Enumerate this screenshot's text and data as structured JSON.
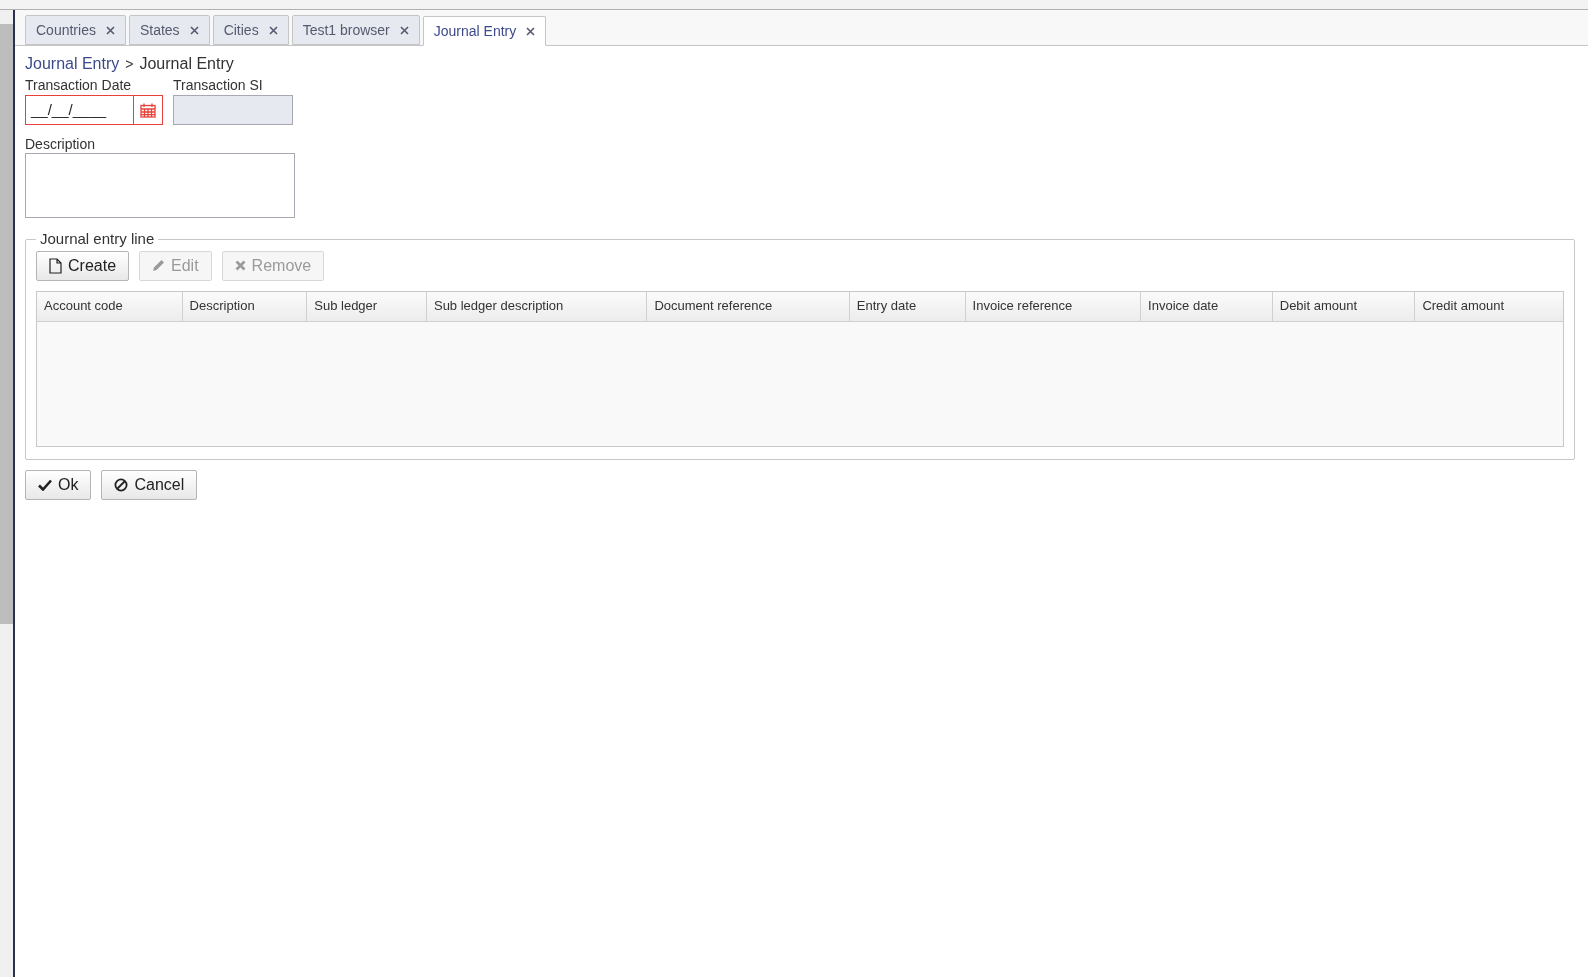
{
  "tabs": [
    {
      "label": "Countries",
      "selected": false
    },
    {
      "label": "States",
      "selected": false
    },
    {
      "label": "Cities",
      "selected": false
    },
    {
      "label": "Test1 browser",
      "selected": false
    },
    {
      "label": "Journal Entry",
      "selected": true
    }
  ],
  "breadcrumb": {
    "link": "Journal Entry",
    "separator": ">",
    "current": "Journal Entry"
  },
  "form": {
    "transaction_date": {
      "label": "Transaction Date",
      "value": "__/__/____",
      "invalid": true
    },
    "transaction_si": {
      "label": "Transaction SI",
      "disabled": true
    },
    "description": {
      "label": "Description"
    }
  },
  "journal_entry_line": {
    "legend": "Journal entry line",
    "buttons": [
      {
        "kind": "create",
        "label": "Create",
        "disabled": false
      },
      {
        "kind": "edit",
        "label": "Edit",
        "disabled": true
      },
      {
        "kind": "remove",
        "label": "Remove",
        "disabled": true
      }
    ],
    "table": {
      "columns": [
        "Account code",
        "Description",
        "Sub ledger",
        "Sub ledger description",
        "Document reference",
        "Entry date",
        "Invoice reference",
        "Invoice date",
        "Debit amount",
        "Credit amount"
      ]
    }
  },
  "buttons": [
    {
      "kind": "ok",
      "label": "Ok"
    },
    {
      "kind": "cancel",
      "label": "Cancel"
    }
  ]
}
